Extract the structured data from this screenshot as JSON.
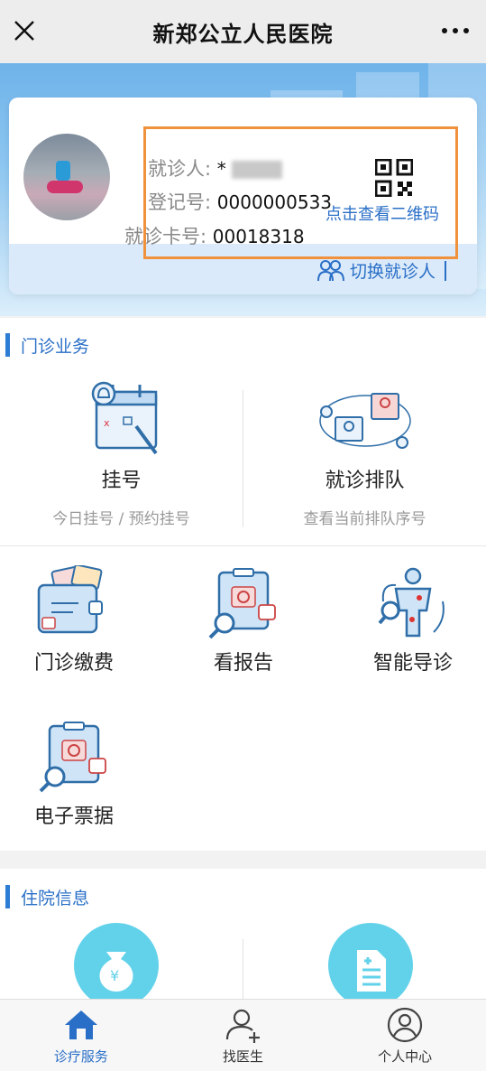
{
  "nav": {
    "title": "新郑公立人民医院",
    "close_icon": "close-icon",
    "more_icon": "more-icon"
  },
  "patient": {
    "name_label": "就诊人:",
    "name_value": "*",
    "reg_label": "登记号:",
    "reg_value": "0000000533",
    "card_label": "就诊卡号:",
    "card_value": "00018318",
    "qr_text": "点击查看二维码",
    "switch_text": "切换就诊人"
  },
  "outpatient": {
    "title": "门诊业务",
    "big": [
      {
        "name": "挂号",
        "sub": "今日挂号 / 预约挂号",
        "icon": "calendar-bell-icon"
      },
      {
        "name": "就诊排队",
        "sub": "查看当前排队序号",
        "icon": "queue-icon"
      }
    ],
    "small": [
      {
        "name": "门诊缴费",
        "icon": "wallet-icon"
      },
      {
        "name": "看报告",
        "icon": "report-icon"
      },
      {
        "name": "智能导诊",
        "icon": "body-guide-icon"
      },
      {
        "name": "电子票据",
        "icon": "receipt-icon"
      }
    ]
  },
  "inpatient": {
    "title": "住院信息"
  },
  "tabs": [
    {
      "label": "诊疗服务",
      "icon": "home-icon",
      "active": true
    },
    {
      "label": "找医生",
      "icon": "add-doctor-icon",
      "active": false
    },
    {
      "label": "个人中心",
      "icon": "user-center-icon",
      "active": false
    }
  ],
  "colors": {
    "accent": "#2a6fc7",
    "highlight": "#f0913e"
  }
}
